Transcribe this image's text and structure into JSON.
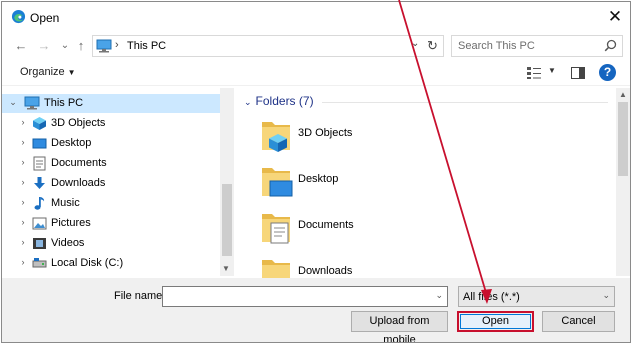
{
  "window": {
    "title": "Open",
    "close_glyph": "✕"
  },
  "nav": {
    "back_glyph": "←",
    "forward_glyph": "→",
    "recent_glyph": "⌄",
    "up_glyph": "↑",
    "address": {
      "path": "This PC",
      "separator": "›",
      "dropdown_glyph": "⌄",
      "refresh_glyph": "↻"
    },
    "search": {
      "placeholder": "Search This PC"
    }
  },
  "toolbar": {
    "organize_label": "Organize",
    "caret": "▼",
    "view_dropdown_glyph": "▼",
    "help_glyph": "?"
  },
  "sidebar": {
    "items": [
      {
        "label": "This PC",
        "icon": "computer-icon",
        "expanded": true,
        "selected": true,
        "arrow": "⌄"
      },
      {
        "label": "3D Objects",
        "icon": "3d-objects-icon",
        "arrow": "›"
      },
      {
        "label": "Desktop",
        "icon": "desktop-icon",
        "arrow": "›"
      },
      {
        "label": "Documents",
        "icon": "documents-icon",
        "arrow": "›"
      },
      {
        "label": "Downloads",
        "icon": "downloads-icon",
        "arrow": "›"
      },
      {
        "label": "Music",
        "icon": "music-icon",
        "arrow": "›"
      },
      {
        "label": "Pictures",
        "icon": "pictures-icon",
        "arrow": "›"
      },
      {
        "label": "Videos",
        "icon": "videos-icon",
        "arrow": "›"
      },
      {
        "label": "Local Disk (C:)",
        "icon": "drive-icon",
        "arrow": "›"
      }
    ],
    "scroll_down_glyph": "▼"
  },
  "content": {
    "group_label": "Folders (7)",
    "group_chevron": "⌄",
    "folders": [
      {
        "label": "3D Objects",
        "icon": "3d-objects-folder-icon"
      },
      {
        "label": "Desktop",
        "icon": "desktop-folder-icon"
      },
      {
        "label": "Documents",
        "icon": "documents-folder-icon"
      },
      {
        "label": "Downloads",
        "icon": "downloads-folder-icon"
      }
    ],
    "scroll_up_glyph": "▲"
  },
  "bottom": {
    "filename_label": "File name:",
    "filename_value": "",
    "dropdown_glyph": "⌄",
    "filter_value": "All files (*.*)",
    "upload_label": "Upload from mobile",
    "open_label": "Open",
    "cancel_label": "Cancel"
  },
  "colors": {
    "accent": "#0078d7",
    "selection": "#cce8ff",
    "annotation": "#c8102e",
    "group_header": "#1e3287",
    "help": "#1565c0"
  }
}
